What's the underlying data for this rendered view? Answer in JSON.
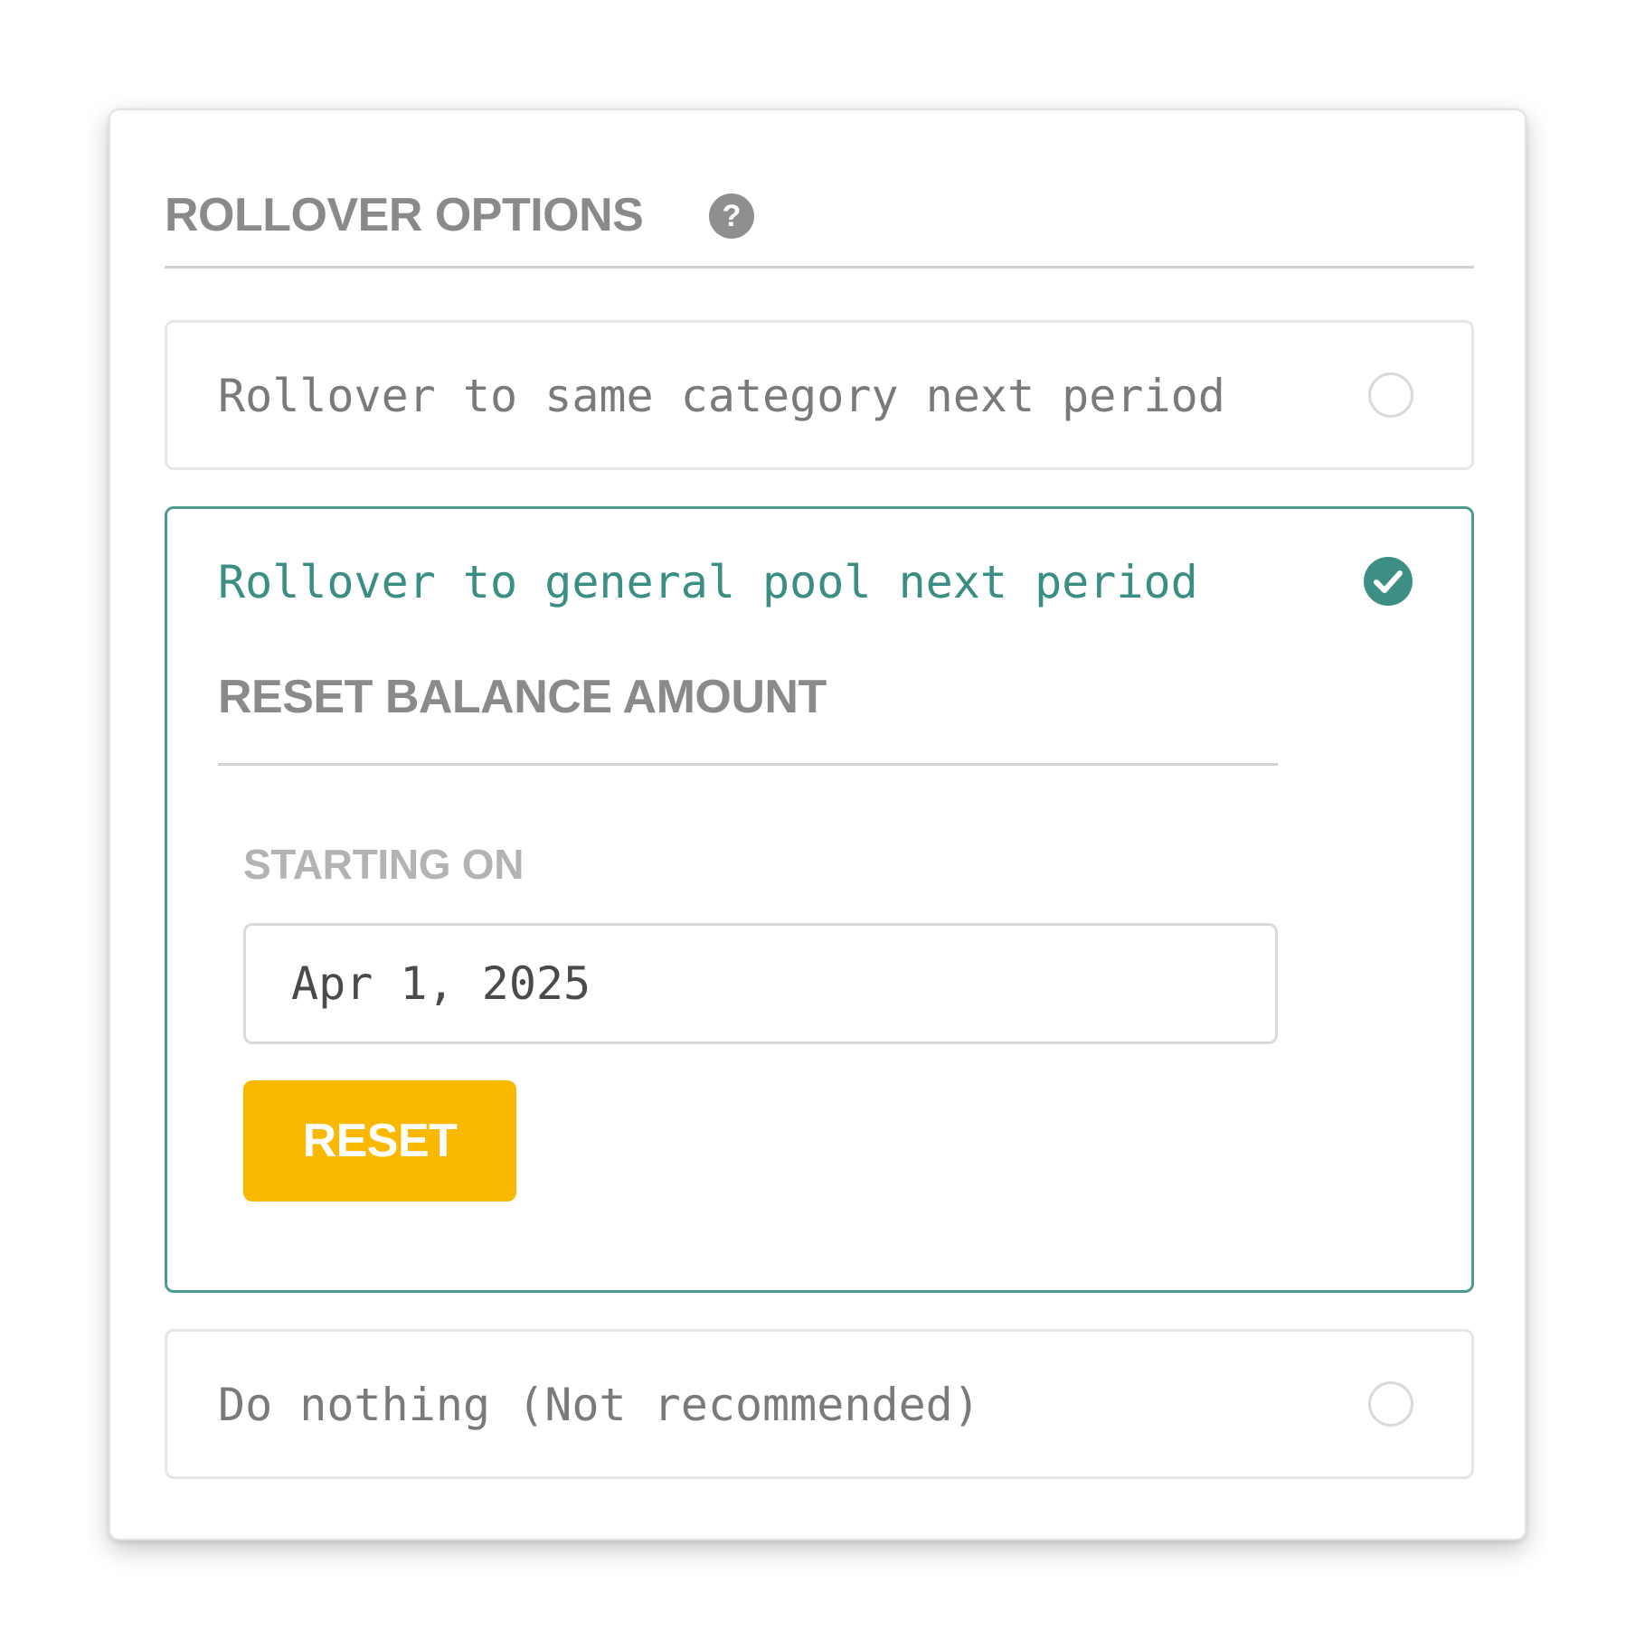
{
  "colors": {
    "accent": "#4e9a91",
    "accent_text": "#3a8e84",
    "muted_text": "#8a8a8a",
    "button": "#fbb800",
    "border": "#e6e6e6"
  },
  "header": {
    "title": "ROLLOVER OPTIONS",
    "help_icon": "question-circle-icon"
  },
  "options": [
    {
      "label": "Rollover to same category next period",
      "selected": false
    },
    {
      "label": "Rollover to general pool next period",
      "selected": true,
      "reset": {
        "title": "RESET BALANCE AMOUNT",
        "starting_label": "STARTING ON",
        "date_value": "Apr 1, 2025",
        "button_label": "RESET"
      }
    },
    {
      "label": "Do nothing (Not recommended)",
      "selected": false
    }
  ]
}
